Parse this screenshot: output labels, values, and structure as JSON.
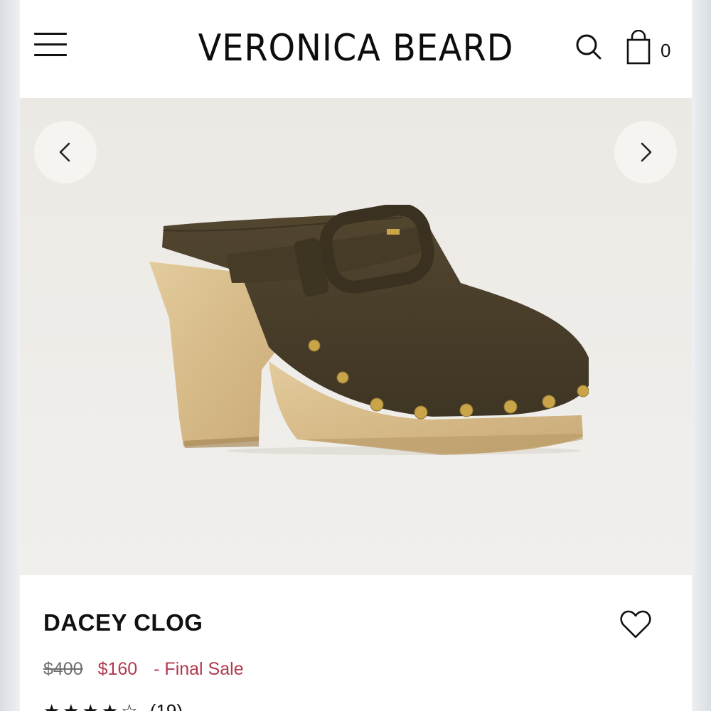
{
  "header": {
    "brand": "VERONICA BEARD",
    "cart_count": "0",
    "icons": [
      "menu-icon",
      "search-icon",
      "shopping-bag-icon"
    ]
  },
  "gallery": {
    "prev_icon": "chevron-left-icon",
    "next_icon": "chevron-right-icon",
    "image": "clog-shoe-image"
  },
  "product": {
    "name": "DACEY CLOG",
    "original_price": "$400",
    "sale_price": "$160",
    "sale_label": "- Final Sale",
    "stars": "★★★★☆",
    "review_count": "(19)",
    "favorite_icon": "heart-icon"
  },
  "colors": {
    "sale": "#b03a4c",
    "gallery_bg": "#ece9e4",
    "suede": "#4a3f2c",
    "wood": "#d8bd8d"
  }
}
